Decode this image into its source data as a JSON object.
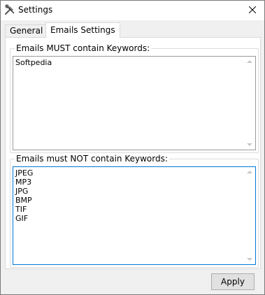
{
  "window": {
    "title": "Settings",
    "app_icon": "wrench-hammer-icon",
    "close_icon": "close-icon"
  },
  "tabs": [
    {
      "label": "General",
      "active": false
    },
    {
      "label": "Emails Settings",
      "active": true
    }
  ],
  "must_contain": {
    "label": "Emails MUST contain Keywords:",
    "lines": [
      "Softpedia"
    ]
  },
  "must_not_contain": {
    "label": "Emails must NOT contain Keywords:",
    "lines": [
      "JPEG",
      "MP3",
      "JPG",
      "BMP",
      "TIF",
      "GIF"
    ]
  },
  "buttons": {
    "apply_label": "Apply"
  },
  "colors": {
    "focus_border": "#0078d7",
    "button_face": "#e1e1e1"
  }
}
